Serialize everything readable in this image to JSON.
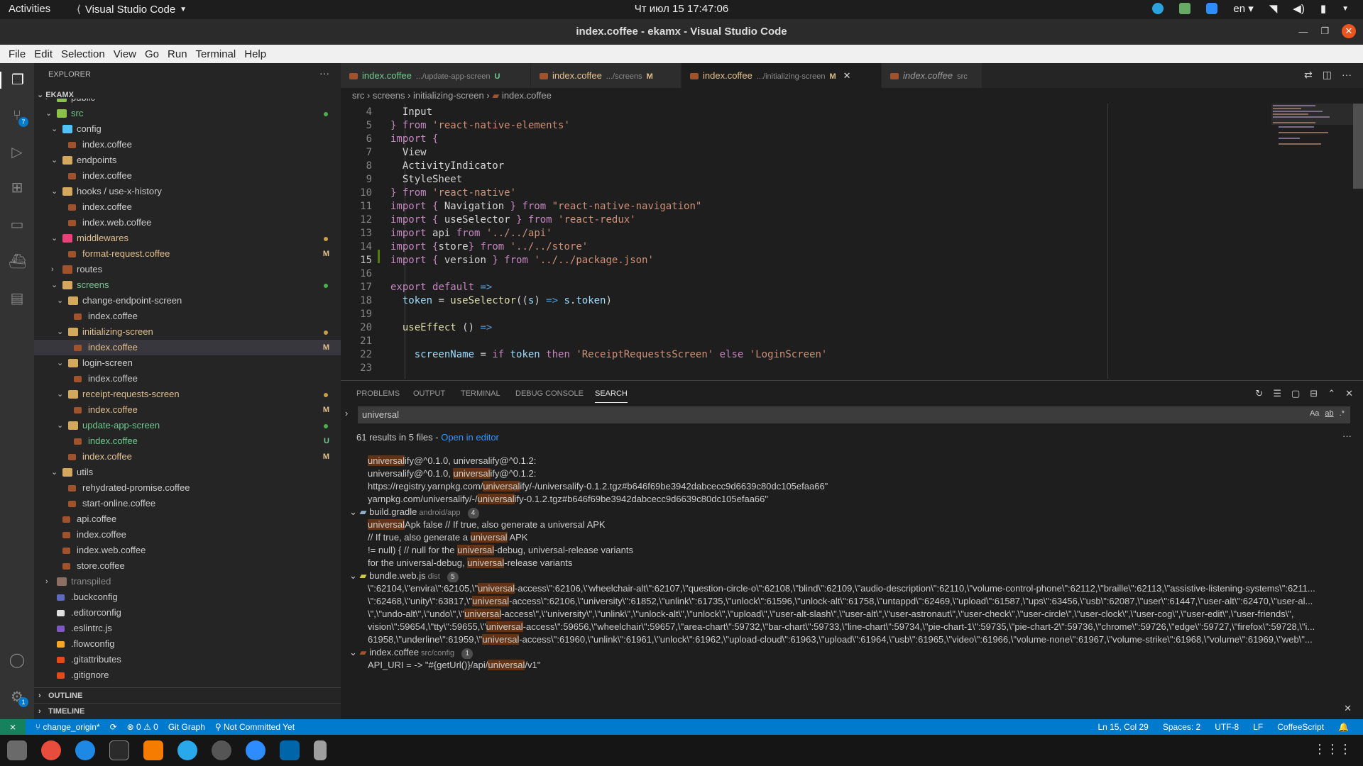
{
  "gnome": {
    "activities": "Activities",
    "app": "Visual Studio Code",
    "clock": "Чт июл 15  17:47:06",
    "lang": "en"
  },
  "window": {
    "title": "index.coffee - ekamx - Visual Studio Code"
  },
  "menu": [
    "File",
    "Edit",
    "Selection",
    "View",
    "Go",
    "Run",
    "Terminal",
    "Help"
  ],
  "activity": {
    "scm_badge": "7",
    "settings_badge": "1"
  },
  "explorer": {
    "header": "EXPLORER",
    "project": "EKAMX",
    "outline": "OUTLINE",
    "timeline": "TIMELINE"
  },
  "tree": [
    {
      "label": "public",
      "depth": 1,
      "type": "folder",
      "chev": "›",
      "color": "#8bc34a"
    },
    {
      "label": "src",
      "depth": 1,
      "type": "folder",
      "chev": "⌄",
      "color": "#8bc34a",
      "dot": "#4caf50",
      "label_color": "#73c991"
    },
    {
      "label": "config",
      "depth": 2,
      "type": "folder",
      "chev": "⌄",
      "color": "#4fc3f7"
    },
    {
      "label": "index.coffee",
      "depth": 3,
      "type": "file"
    },
    {
      "label": "endpoints",
      "depth": 2,
      "type": "folder",
      "chev": "⌄",
      "color": "#d4a85c"
    },
    {
      "label": "index.coffee",
      "depth": 3,
      "type": "file"
    },
    {
      "label": "hooks / use-x-history",
      "depth": 2,
      "type": "folder",
      "chev": "⌄",
      "color": "#d4a85c"
    },
    {
      "label": "index.coffee",
      "depth": 3,
      "type": "file"
    },
    {
      "label": "index.web.coffee",
      "depth": 3,
      "type": "file"
    },
    {
      "label": "middlewares",
      "depth": 2,
      "type": "folder",
      "chev": "⌄",
      "color": "#ec407a",
      "dot": "#c8a04a",
      "label_color": "#e2c08d"
    },
    {
      "label": "format-request.coffee",
      "depth": 3,
      "type": "file",
      "status": "M",
      "label_color": "#e2c08d"
    },
    {
      "label": "routes",
      "depth": 2,
      "type": "folder",
      "chev": "›",
      "color": "#a0522d"
    },
    {
      "label": "screens",
      "depth": 2,
      "type": "folder",
      "chev": "⌄",
      "color": "#d4a85c",
      "dot": "#4caf50",
      "label_color": "#73c991"
    },
    {
      "label": "change-endpoint-screen",
      "depth": 3,
      "type": "folder",
      "chev": "⌄",
      "color": "#d4a85c"
    },
    {
      "label": "index.coffee",
      "depth": 4,
      "type": "file"
    },
    {
      "label": "initializing-screen",
      "depth": 3,
      "type": "folder",
      "chev": "⌄",
      "color": "#d4a85c",
      "dot": "#c8a04a",
      "label_color": "#e2c08d"
    },
    {
      "label": "index.coffee",
      "depth": 4,
      "type": "file",
      "status": "M",
      "label_color": "#e2c08d",
      "selected": true
    },
    {
      "label": "login-screen",
      "depth": 3,
      "type": "folder",
      "chev": "⌄",
      "color": "#d4a85c"
    },
    {
      "label": "index.coffee",
      "depth": 4,
      "type": "file"
    },
    {
      "label": "receipt-requests-screen",
      "depth": 3,
      "type": "folder",
      "chev": "⌄",
      "color": "#d4a85c",
      "dot": "#c8a04a",
      "label_color": "#e2c08d"
    },
    {
      "label": "index.coffee",
      "depth": 4,
      "type": "file",
      "status": "M",
      "label_color": "#e2c08d"
    },
    {
      "label": "update-app-screen",
      "depth": 3,
      "type": "folder",
      "chev": "⌄",
      "color": "#d4a85c",
      "dot": "#4caf50",
      "label_color": "#73c991"
    },
    {
      "label": "index.coffee",
      "depth": 4,
      "type": "file",
      "status": "U",
      "label_color": "#73c991"
    },
    {
      "label": "index.coffee",
      "depth": 3,
      "type": "file",
      "status": "M",
      "label_color": "#e2c08d"
    },
    {
      "label": "utils",
      "depth": 2,
      "type": "folder",
      "chev": "⌄",
      "color": "#d4a85c"
    },
    {
      "label": "rehydrated-promise.coffee",
      "depth": 3,
      "type": "file"
    },
    {
      "label": "start-online.coffee",
      "depth": 3,
      "type": "file"
    },
    {
      "label": "api.coffee",
      "depth": 2,
      "type": "file"
    },
    {
      "label": "index.coffee",
      "depth": 2,
      "type": "file"
    },
    {
      "label": "index.web.coffee",
      "depth": 2,
      "type": "file"
    },
    {
      "label": "store.coffee",
      "depth": 2,
      "type": "file"
    },
    {
      "label": "transpiled",
      "depth": 1,
      "type": "folder",
      "chev": "›",
      "color": "#8d6e63",
      "label_color": "#8c8c8c"
    },
    {
      "label": ".buckconfig",
      "depth": 1,
      "type": "file",
      "color": "#5c6bc0"
    },
    {
      "label": ".editorconfig",
      "depth": 1,
      "type": "file",
      "color": "#e0e0e0"
    },
    {
      "label": ".eslintrc.js",
      "depth": 1,
      "type": "file",
      "color": "#7e57c2"
    },
    {
      "label": ".flowconfig",
      "depth": 1,
      "type": "file",
      "color": "#f9a825"
    },
    {
      "label": ".gitattributes",
      "depth": 1,
      "type": "file",
      "color": "#e64a19"
    },
    {
      "label": ".gitignore",
      "depth": 1,
      "type": "file",
      "color": "#e64a19"
    }
  ],
  "tabs": [
    {
      "name": "index.coffee",
      "desc": ".../update-app-screen",
      "status": "U",
      "color": "#73c991"
    },
    {
      "name": "index.coffee",
      "desc": ".../screens",
      "status": "M",
      "color": "#e2c08d"
    },
    {
      "name": "index.coffee",
      "desc": ".../initializing-screen",
      "status": "M",
      "color": "#e2c08d",
      "close": "✕"
    },
    {
      "name": "index.coffee",
      "desc": "src",
      "status": "",
      "color": "#9d9d9d"
    }
  ],
  "breadcrumb": {
    "a": "src",
    "b": "screens",
    "c": "initializing-screen",
    "d": "index.coffee"
  },
  "code": [
    {
      "n": "4",
      "t": [
        [
          "pl",
          "  Input"
        ]
      ]
    },
    {
      "n": "5",
      "t": [
        [
          "kw",
          "} "
        ],
        [
          "kw",
          "from "
        ],
        [
          "str",
          "'react-native-elements'"
        ]
      ]
    },
    {
      "n": "6",
      "t": [
        [
          "kw",
          "import "
        ],
        [
          "kw",
          "{"
        ]
      ]
    },
    {
      "n": "7",
      "t": [
        [
          "pl",
          "  View"
        ]
      ]
    },
    {
      "n": "8",
      "t": [
        [
          "pl",
          "  ActivityIndicator"
        ]
      ]
    },
    {
      "n": "9",
      "t": [
        [
          "pl",
          "  StyleSheet"
        ]
      ]
    },
    {
      "n": "10",
      "t": [
        [
          "kw",
          "} "
        ],
        [
          "kw",
          "from "
        ],
        [
          "str",
          "'react-native'"
        ]
      ]
    },
    {
      "n": "11",
      "t": [
        [
          "kw",
          "import "
        ],
        [
          "kw",
          "{ "
        ],
        [
          "pl",
          "Navigation "
        ],
        [
          "kw",
          "} "
        ],
        [
          "kw",
          "from "
        ],
        [
          "str",
          "\"react-native-navigation\""
        ]
      ]
    },
    {
      "n": "12",
      "t": [
        [
          "kw",
          "import "
        ],
        [
          "kw",
          "{ "
        ],
        [
          "pl",
          "useSelector "
        ],
        [
          "kw",
          "} "
        ],
        [
          "kw",
          "from "
        ],
        [
          "str",
          "'react-redux'"
        ]
      ]
    },
    {
      "n": "13",
      "t": [
        [
          "kw",
          "import "
        ],
        [
          "pl",
          "api "
        ],
        [
          "kw",
          "from "
        ],
        [
          "str",
          "'../../api'"
        ]
      ]
    },
    {
      "n": "14",
      "t": [
        [
          "kw",
          "import "
        ],
        [
          "kw",
          "{"
        ],
        [
          "pl",
          "store"
        ],
        [
          "kw",
          "} "
        ],
        [
          "kw",
          "from "
        ],
        [
          "str",
          "'../../store'"
        ]
      ]
    },
    {
      "n": "15",
      "t": [
        [
          "kw",
          "import "
        ],
        [
          "kw",
          "{ "
        ],
        [
          "pl",
          "version "
        ],
        [
          "kw",
          "} "
        ],
        [
          "kw",
          "from "
        ],
        [
          "str",
          "'../../package.json'"
        ]
      ]
    },
    {
      "n": "16",
      "t": []
    },
    {
      "n": "17",
      "t": [
        [
          "kw",
          "export "
        ],
        [
          "kw",
          "default "
        ],
        [
          "op",
          "=>"
        ]
      ]
    },
    {
      "n": "18",
      "t": [
        [
          "pl",
          "  "
        ],
        [
          "id",
          "token "
        ],
        [
          "pl",
          "= "
        ],
        [
          "fn",
          "useSelector"
        ],
        [
          "pl",
          "(("
        ],
        [
          "id",
          "s"
        ],
        [
          "pl",
          ") "
        ],
        [
          "op",
          "=> "
        ],
        [
          "id",
          "s"
        ],
        [
          "pl",
          "."
        ],
        [
          "id",
          "token"
        ],
        [
          "pl",
          ")"
        ]
      ]
    },
    {
      "n": "19",
      "t": []
    },
    {
      "n": "20",
      "t": [
        [
          "pl",
          "  "
        ],
        [
          "fn",
          "useEffect "
        ],
        [
          "pl",
          "() "
        ],
        [
          "op",
          "=>"
        ]
      ]
    },
    {
      "n": "21",
      "t": []
    },
    {
      "n": "22",
      "t": [
        [
          "pl",
          "    "
        ],
        [
          "id",
          "screenName "
        ],
        [
          "pl",
          "= "
        ],
        [
          "kw",
          "if "
        ],
        [
          "id",
          "token "
        ],
        [
          "kw",
          "then "
        ],
        [
          "str",
          "'ReceiptRequestsScreen' "
        ],
        [
          "kw",
          "else "
        ],
        [
          "str",
          "'LoginScreen'"
        ]
      ]
    },
    {
      "n": "23",
      "t": []
    }
  ],
  "panel": {
    "tabs": [
      "PROBLEMS",
      "OUTPUT",
      "TERMINAL",
      "DEBUG CONSOLE",
      "SEARCH"
    ],
    "query": "universal",
    "summary": "61 results in 5 files - ",
    "open_in_editor": "Open in editor",
    "opt_case": "Aa",
    "opt_word": "ab",
    "opt_regex": ".*"
  },
  "results": [
    {
      "kind": "line",
      "parts": [
        [
          "m",
          "universal"
        ],
        [
          "t",
          "ify@^0.1.0, universalify@^0.1.2:"
        ]
      ]
    },
    {
      "kind": "line",
      "parts": [
        [
          "t",
          "universalify@^0.1.0, "
        ],
        [
          "m",
          "universal"
        ],
        [
          "t",
          "ify@^0.1.2:"
        ]
      ]
    },
    {
      "kind": "line",
      "parts": [
        [
          "t",
          "https://registry.yarnpkg.com/"
        ],
        [
          "m",
          "universal"
        ],
        [
          "t",
          "ify/-/universalify-0.1.2.tgz#b646f69be3942dabcecc9d6639c80dc105efaa66\""
        ]
      ]
    },
    {
      "kind": "line",
      "parts": [
        [
          "t",
          "yarnpkg.com/universalify/-/"
        ],
        [
          "m",
          "universal"
        ],
        [
          "t",
          "ify-0.1.2.tgz#b646f69be3942dabcecc9d6639c80dc105efaa66\""
        ]
      ]
    },
    {
      "kind": "file",
      "name": "build.gradle",
      "path": "android/app",
      "count": "4",
      "icon": "#8fb3c9"
    },
    {
      "kind": "line",
      "parts": [
        [
          "m",
          "universal"
        ],
        [
          "t",
          "Apk false  // If true, also generate a universal APK"
        ]
      ]
    },
    {
      "kind": "line",
      "parts": [
        [
          "t",
          "// If true, also generate a "
        ],
        [
          "m",
          "universal"
        ],
        [
          "t",
          " APK"
        ]
      ]
    },
    {
      "kind": "line",
      "parts": [
        [
          "t",
          "!= null) {  // null for the "
        ],
        [
          "m",
          "universal"
        ],
        [
          "t",
          "-debug, universal-release variants"
        ]
      ]
    },
    {
      "kind": "line",
      "parts": [
        [
          "t",
          "for the universal-debug, "
        ],
        [
          "m",
          "universal"
        ],
        [
          "t",
          "-release variants"
        ]
      ]
    },
    {
      "kind": "file",
      "name": "bundle.web.js",
      "path": "dist",
      "count": "5",
      "icon": "#cbcb41"
    },
    {
      "kind": "line",
      "parts": [
        [
          "t",
          "\\\":62104,\\\"envira\\\":62105,\\\""
        ],
        [
          "m",
          "universal"
        ],
        [
          "t",
          "-access\\\":62106,\\\"wheelchair-alt\\\":62107,\\\"question-circle-o\\\":62108,\\\"blind\\\":62109,\\\"audio-description\\\":62110,\\\"volume-control-phone\\\":62112,\\\"braille\\\":62113,\\\"assistive-listening-systems\\\":6211..."
        ]
      ]
    },
    {
      "kind": "line",
      "parts": [
        [
          "t",
          "\\\":62468,\\\"unity\\\":63817,\\\""
        ],
        [
          "m",
          "universal"
        ],
        [
          "t",
          "-access\\\":62106,\\\"university\\\":61852,\\\"unlink\\\":61735,\\\"unlock\\\":61596,\\\"unlock-alt\\\":61758,\\\"untappd\\\":62469,\\\"upload\\\":61587,\\\"ups\\\":63456,\\\"usb\\\":62087,\\\"user\\\":61447,\\\"user-alt\\\":62470,\\\"user-al..."
        ]
      ]
    },
    {
      "kind": "line",
      "parts": [
        [
          "t",
          "\\\",\\\"undo-alt\\\",\\\"undo\\\",\\\""
        ],
        [
          "m",
          "universal"
        ],
        [
          "t",
          "-access\\\",\\\"university\\\",\\\"unlink\\\",\\\"unlock-alt\\\",\\\"unlock\\\",\\\"upload\\\",\\\"user-alt-slash\\\",\\\"user-alt\\\",\\\"user-astronaut\\\",\\\"user-check\\\",\\\"user-circle\\\",\\\"user-clock\\\",\\\"user-cog\\\",\\\"user-edit\\\",\\\"user-friends\\\","
        ]
      ]
    },
    {
      "kind": "line",
      "parts": [
        [
          "t",
          "vision\\\":59654,\\\"tty\\\":59655,\\\""
        ],
        [
          "m",
          "universal"
        ],
        [
          "t",
          "-access\\\":59656,\\\"wheelchair\\\":59657,\\\"area-chart\\\":59732,\\\"bar-chart\\\":59733,\\\"line-chart\\\":59734,\\\"pie-chart-1\\\":59735,\\\"pie-chart-2\\\":59736,\\\"chrome\\\":59726,\\\"edge\\\":59727,\\\"firefox\\\":59728,\\\"i..."
        ]
      ]
    },
    {
      "kind": "line",
      "parts": [
        [
          "t",
          "61958,\\\"underline\\\":61959,\\\""
        ],
        [
          "m",
          "universal"
        ],
        [
          "t",
          "-access\\\":61960,\\\"unlink\\\":61961,\\\"unlock\\\":61962,\\\"upload-cloud\\\":61963,\\\"upload\\\":61964,\\\"usb\\\":61965,\\\"video\\\":61966,\\\"volume-none\\\":61967,\\\"volume-strike\\\":61968,\\\"volume\\\":61969,\\\"web\\\"..."
        ]
      ]
    },
    {
      "kind": "file",
      "name": "index.coffee",
      "path": "src/config",
      "count": "1",
      "icon": "#a0522d"
    },
    {
      "kind": "line",
      "parts": [
        [
          "t",
          "API_URI = -> \"#{getUrl()}/api/"
        ],
        [
          "m",
          "universal"
        ],
        [
          "t",
          "/v1\""
        ]
      ]
    }
  ],
  "status": {
    "branch": "change_origin*",
    "errors": "⊗ 0",
    "warnings": "⚠ 0",
    "gitgraph": "Git Graph",
    "commit": "Not Committed Yet",
    "position": "Ln 15, Col 29",
    "spaces": "Spaces: 2",
    "encoding": "UTF-8",
    "eol": "LF",
    "language": "CoffeeScript"
  },
  "colors": {
    "accent": "#007acc",
    "match": "#623315"
  }
}
